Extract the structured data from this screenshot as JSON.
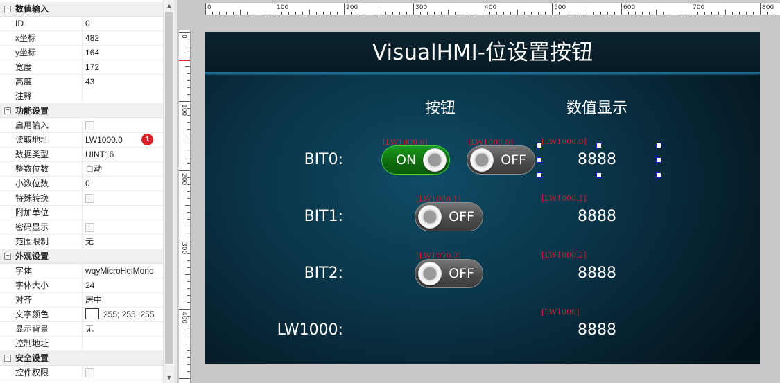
{
  "properties": {
    "groups": [
      {
        "label": "数值输入",
        "toggle": "⊟",
        "rows": [
          {
            "key": "ID",
            "value": "0"
          },
          {
            "key": "x坐标",
            "value": "482"
          },
          {
            "key": "y坐标",
            "value": "164"
          },
          {
            "key": "宽度",
            "value": "172"
          },
          {
            "key": "高度",
            "value": "43"
          },
          {
            "key": "注释",
            "value": ""
          }
        ]
      },
      {
        "label": "功能设置",
        "toggle": "⊟",
        "rows": [
          {
            "key": "启用输入",
            "value": ""
          },
          {
            "key": "读取地址",
            "value": "LW1000.0"
          },
          {
            "key": "数据类型",
            "value": "UINT16"
          },
          {
            "key": "整数位数",
            "value": "自动"
          },
          {
            "key": "小数位数",
            "value": "0"
          },
          {
            "key": "特殊转换",
            "value": ""
          },
          {
            "key": "附加单位",
            "value": ""
          },
          {
            "key": "密码显示",
            "value": ""
          },
          {
            "key": "范围限制",
            "value": "无"
          }
        ]
      },
      {
        "label": "外观设置",
        "toggle": "⊟",
        "rows": [
          {
            "key": "字体",
            "value": "wqyMicroHeiMono"
          },
          {
            "key": "字体大小",
            "value": "24"
          },
          {
            "key": "对齐",
            "value": "居中"
          },
          {
            "key": "文字颜色",
            "value": "255; 255; 255"
          },
          {
            "key": "显示背景",
            "value": "无"
          },
          {
            "key": "控制地址",
            "value": ""
          }
        ]
      },
      {
        "label": "安全设置",
        "toggle": "⊟",
        "rows": [
          {
            "key": "控件权限",
            "value": ""
          }
        ]
      }
    ],
    "badge": "1",
    "text_color_swatch": "#ffffff"
  },
  "ruler": {
    "h_labels": [
      "0",
      "100",
      "200",
      "300",
      "400",
      "500",
      "600",
      "700",
      "800"
    ],
    "v_labels": [
      "0",
      "100",
      "200",
      "300",
      "400"
    ]
  },
  "hmi": {
    "title": "VisualHMI-位设置按钮",
    "col_button": "按钮",
    "col_value": "数值显示",
    "rows": [
      {
        "label": "BIT0:",
        "addr_on": "[LW1000.0]",
        "addr_off": "[LW1000.0]",
        "addr_value": "[LW1000.0]",
        "on_text": "ON",
        "off_text": "OFF",
        "value": "8888"
      },
      {
        "label": "BIT1:",
        "addr_btn": "[LW1000.1]",
        "addr_value": "[LW1000.1]",
        "btn_text": "OFF",
        "value": "8888"
      },
      {
        "label": "BIT2:",
        "addr_btn": "[LW1000.2]",
        "addr_value": "[LW1000.2]",
        "btn_text": "OFF",
        "value": "8888"
      },
      {
        "label": "LW1000:",
        "addr_value": "[LW1000]",
        "value": "8888"
      }
    ],
    "colors": {
      "on": "#119311",
      "off": "#555555",
      "address": "#c8202a",
      "screen_bg": "#0a3448"
    }
  }
}
